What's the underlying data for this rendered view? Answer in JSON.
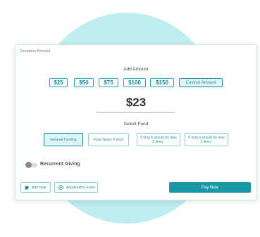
{
  "card": {
    "title": "Donation Amount"
  },
  "add_amount": {
    "label": "Add Amount",
    "options": [
      "$25",
      "$50",
      "$75",
      "$100",
      "$150"
    ],
    "custom_label": "Custom Amount",
    "current_amount": "$23"
  },
  "select_fund": {
    "label": "Select Fund",
    "funds": [
      "General Funding",
      "Fund Name if short",
      "If long it should be max 2 lines..",
      "If long it should be max 2 lines.."
    ]
  },
  "recurrent": {
    "label": "Recurrent Giving",
    "enabled": false
  },
  "actions": {
    "add_note": "Add Note",
    "add_fund": "Add Another Fund",
    "pay_now": "Pay Now"
  },
  "colors": {
    "accent": "#1a98a6",
    "blob": "#bfeef0",
    "selected_bg": "#dff4f6"
  }
}
